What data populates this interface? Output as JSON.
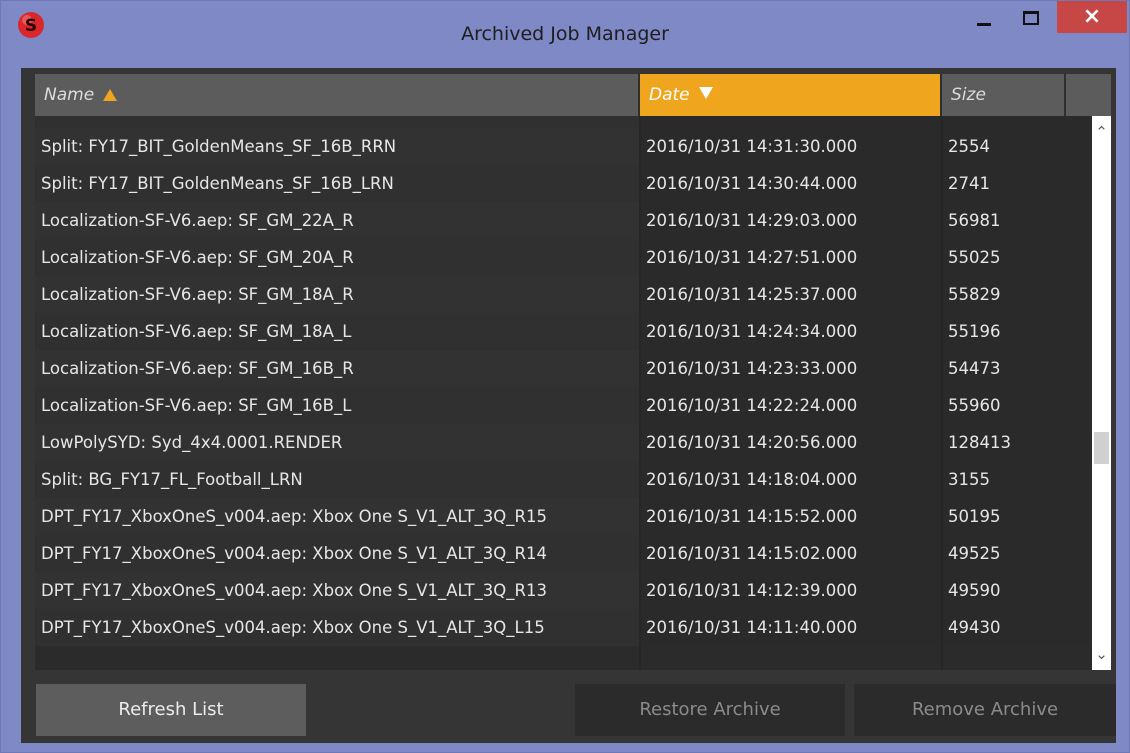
{
  "window": {
    "title": "Archived Job Manager",
    "icon": "app-logo-icon",
    "controls": {
      "minimize": "minimize-icon",
      "maximize": "maximize-icon",
      "close": "×"
    }
  },
  "table": {
    "columns": {
      "name": "Name",
      "date": "Date",
      "size": "Size"
    },
    "sort": {
      "name": "ascending",
      "date": "descending"
    },
    "rows": [
      {
        "name": "Split: FY17_BIT_GoldenMeans_SF_16B_RRN",
        "date": "2016/10/31 14:31:30.000",
        "size": "2554"
      },
      {
        "name": "Split: FY17_BIT_GoldenMeans_SF_16B_LRN",
        "date": "2016/10/31 14:30:44.000",
        "size": "2741"
      },
      {
        "name": "Localization-SF-V6.aep: SF_GM_22A_R",
        "date": "2016/10/31 14:29:03.000",
        "size": "56981"
      },
      {
        "name": "Localization-SF-V6.aep: SF_GM_20A_R",
        "date": "2016/10/31 14:27:51.000",
        "size": "55025"
      },
      {
        "name": "Localization-SF-V6.aep: SF_GM_18A_R",
        "date": "2016/10/31 14:25:37.000",
        "size": "55829"
      },
      {
        "name": "Localization-SF-V6.aep: SF_GM_18A_L",
        "date": "2016/10/31 14:24:34.000",
        "size": "55196"
      },
      {
        "name": "Localization-SF-V6.aep: SF_GM_16B_R",
        "date": "2016/10/31 14:23:33.000",
        "size": "54473"
      },
      {
        "name": "Localization-SF-V6.aep: SF_GM_16B_L",
        "date": "2016/10/31 14:22:24.000",
        "size": "55960"
      },
      {
        "name": "LowPolySYD: Syd_4x4.0001.RENDER",
        "date": "2016/10/31 14:20:56.000",
        "size": "128413"
      },
      {
        "name": "Split: BG_FY17_FL_Football_LRN",
        "date": "2016/10/31 14:18:04.000",
        "size": "3155"
      },
      {
        "name": "DPT_FY17_XboxOneS_v004.aep: Xbox One S_V1_ALT_3Q_R15",
        "date": "2016/10/31 14:15:52.000",
        "size": "50195"
      },
      {
        "name": "DPT_FY17_XboxOneS_v004.aep: Xbox One S_V1_ALT_3Q_R14",
        "date": "2016/10/31 14:15:02.000",
        "size": "49525"
      },
      {
        "name": "DPT_FY17_XboxOneS_v004.aep: Xbox One S_V1_ALT_3Q_R13",
        "date": "2016/10/31 14:12:39.000",
        "size": "49590"
      },
      {
        "name": "DPT_FY17_XboxOneS_v004.aep: Xbox One S_V1_ALT_3Q_L15",
        "date": "2016/10/31 14:11:40.000",
        "size": "49430"
      }
    ]
  },
  "scrollbar": {
    "up": "⌃",
    "down": "⌄"
  },
  "buttons": {
    "refresh": "Refresh List",
    "restore": "Restore Archive",
    "remove": "Remove Archive"
  },
  "colors": {
    "frame": "#7f89c6",
    "sorted_header": "#f0a51e",
    "close_button": "#c74747",
    "panel": "#353535"
  }
}
